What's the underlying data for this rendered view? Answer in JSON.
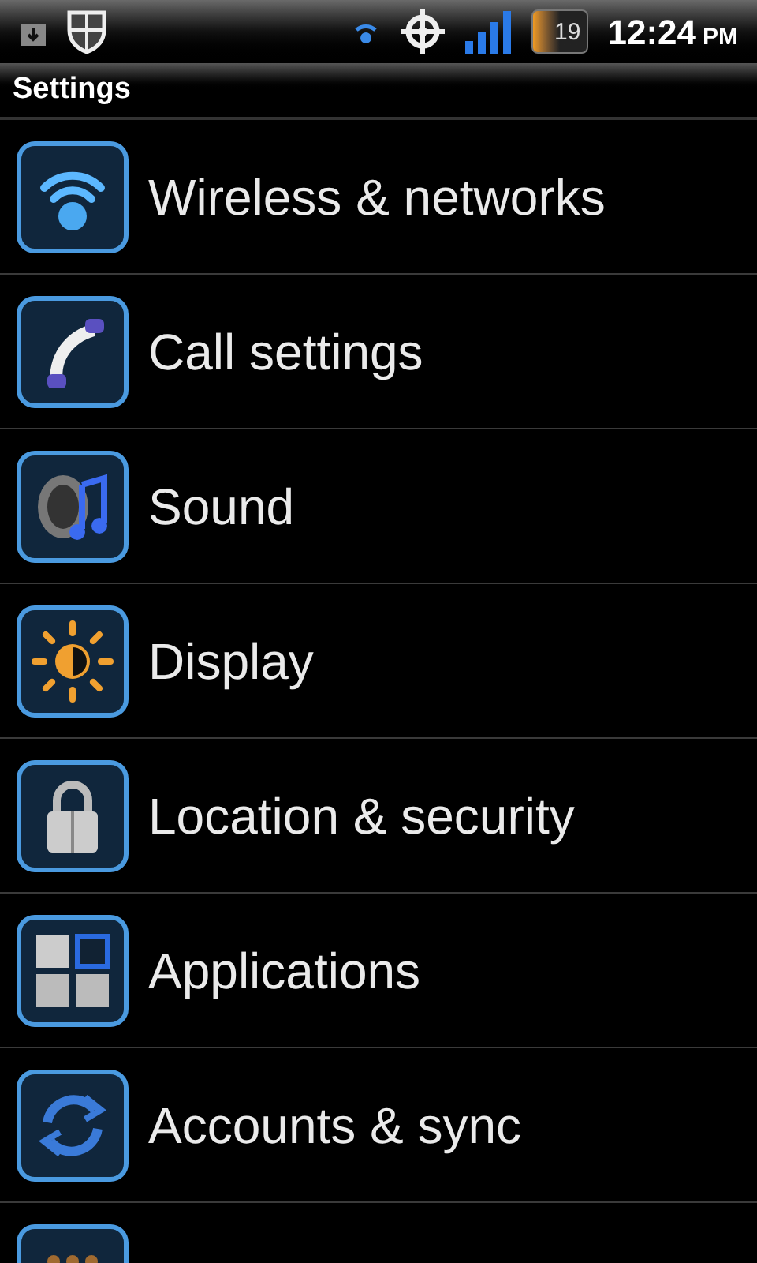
{
  "status_bar": {
    "battery": "19",
    "time": "12:24",
    "ampm": "PM"
  },
  "title": "Settings",
  "items": [
    {
      "kind": "full",
      "label": "Wireless & networks"
    },
    {
      "kind": "full",
      "label": "Call settings"
    },
    {
      "kind": "full",
      "label": "Sound"
    },
    {
      "kind": "full",
      "label": "Display"
    },
    {
      "kind": "full",
      "label": "Location & security"
    },
    {
      "kind": "full",
      "label": "Applications"
    },
    {
      "kind": "full",
      "label": "Accounts & sync"
    },
    {
      "kind": "partial"
    }
  ]
}
